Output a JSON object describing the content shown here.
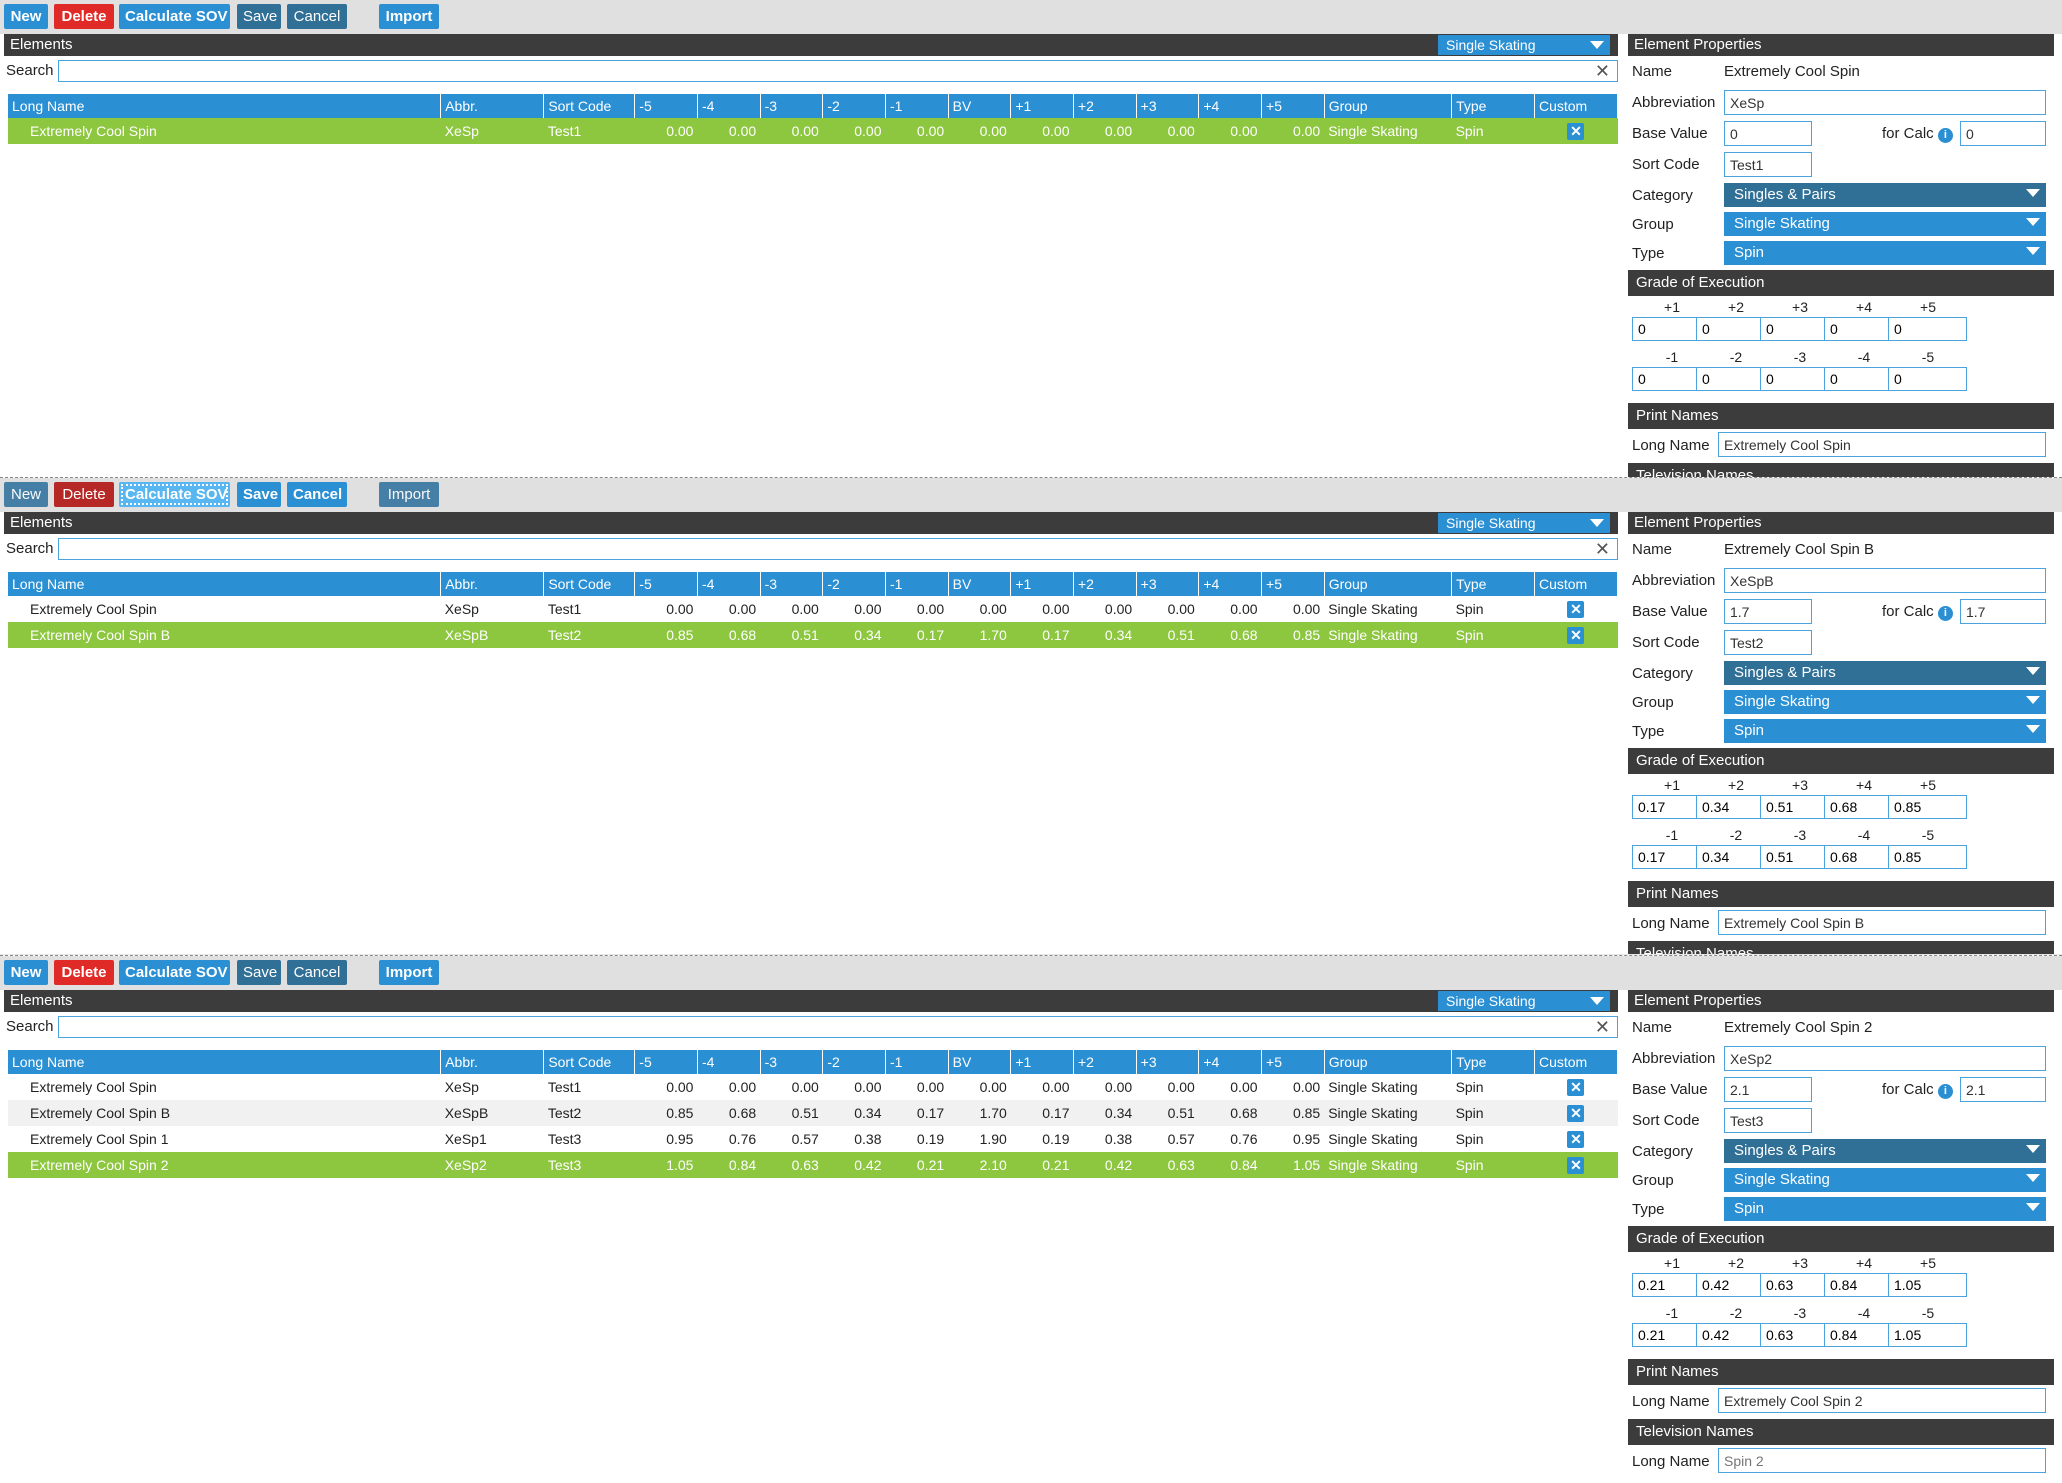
{
  "toolbar": {
    "new": "New",
    "delete": "Delete",
    "calc": "Calculate SOV",
    "save": "Save",
    "cancel": "Cancel",
    "import": "Import"
  },
  "elements_title": "Elements",
  "discipline": "Single Skating",
  "search_label": "Search",
  "columns": [
    "Long Name",
    "Abbr.",
    "Sort Code",
    "-5",
    "-4",
    "-3",
    "-2",
    "-1",
    "BV",
    "+1",
    "+2",
    "+3",
    "+4",
    "+5",
    "Group",
    "Type",
    "Custom"
  ],
  "props_labels": {
    "title": "Element Properties",
    "name": "Name",
    "abbr": "Abbreviation",
    "base": "Base Value",
    "for_calc": "for Calc",
    "sort": "Sort Code",
    "category": "Category",
    "group": "Group",
    "type": "Type",
    "goe": "Grade of Execution",
    "print": "Print Names",
    "tv": "Television Names",
    "long_name": "Long Name"
  },
  "goe_plus_labels": [
    "+1",
    "+2",
    "+3",
    "+4",
    "+5"
  ],
  "goe_minus_labels": [
    "-1",
    "-2",
    "-3",
    "-4",
    "-5"
  ],
  "panels": [
    {
      "rows": [
        [
          "Extremely Cool Spin",
          "XeSp",
          "Test1",
          "0.00",
          "0.00",
          "0.00",
          "0.00",
          "0.00",
          "0.00",
          "0.00",
          "0.00",
          "0.00",
          "0.00",
          "0.00",
          "Single Skating",
          "Spin"
        ]
      ],
      "selected": 0,
      "props": {
        "name": "Extremely Cool Spin",
        "abbr": "XeSp",
        "base": "0",
        "for_calc": "0",
        "sort": "Test1",
        "category": "Singles & Pairs",
        "group": "Single Skating",
        "type": "Spin",
        "goe_plus": [
          "0",
          "0",
          "0",
          "0",
          "0"
        ],
        "goe_minus": [
          "0",
          "0",
          "0",
          "0",
          "0"
        ],
        "print_long": "Extremely Cool Spin",
        "tv_long": ""
      }
    },
    {
      "rows": [
        [
          "Extremely Cool Spin",
          "XeSp",
          "Test1",
          "0.00",
          "0.00",
          "0.00",
          "0.00",
          "0.00",
          "0.00",
          "0.00",
          "0.00",
          "0.00",
          "0.00",
          "0.00",
          "Single Skating",
          "Spin"
        ],
        [
          "Extremely Cool Spin B",
          "XeSpB",
          "Test2",
          "0.85",
          "0.68",
          "0.51",
          "0.34",
          "0.17",
          "1.70",
          "0.17",
          "0.34",
          "0.51",
          "0.68",
          "0.85",
          "Single Skating",
          "Spin"
        ]
      ],
      "selected": 1,
      "props": {
        "name": "Extremely Cool Spin B",
        "abbr": "XeSpB",
        "base": "1.7",
        "for_calc": "1.7",
        "sort": "Test2",
        "category": "Singles & Pairs",
        "group": "Single Skating",
        "type": "Spin",
        "goe_plus": [
          "0.17",
          "0.34",
          "0.51",
          "0.68",
          "0.85"
        ],
        "goe_minus": [
          "0.17",
          "0.34",
          "0.51",
          "0.68",
          "0.85"
        ],
        "print_long": "Extremely Cool Spin B",
        "tv_long": ""
      }
    },
    {
      "rows": [
        [
          "Extremely Cool Spin",
          "XeSp",
          "Test1",
          "0.00",
          "0.00",
          "0.00",
          "0.00",
          "0.00",
          "0.00",
          "0.00",
          "0.00",
          "0.00",
          "0.00",
          "0.00",
          "Single Skating",
          "Spin"
        ],
        [
          "Extremely Cool Spin B",
          "XeSpB",
          "Test2",
          "0.85",
          "0.68",
          "0.51",
          "0.34",
          "0.17",
          "1.70",
          "0.17",
          "0.34",
          "0.51",
          "0.68",
          "0.85",
          "Single Skating",
          "Spin"
        ],
        [
          "Extremely Cool Spin 1",
          "XeSp1",
          "Test3",
          "0.95",
          "0.76",
          "0.57",
          "0.38",
          "0.19",
          "1.90",
          "0.19",
          "0.38",
          "0.57",
          "0.76",
          "0.95",
          "Single Skating",
          "Spin"
        ],
        [
          "Extremely Cool Spin 2",
          "XeSp2",
          "Test3",
          "1.05",
          "0.84",
          "0.63",
          "0.42",
          "0.21",
          "2.10",
          "0.21",
          "0.42",
          "0.63",
          "0.84",
          "1.05",
          "Single Skating",
          "Spin"
        ]
      ],
      "selected": 3,
      "props": {
        "name": "Extremely Cool Spin 2",
        "abbr": "XeSp2",
        "base": "2.1",
        "for_calc": "2.1",
        "sort": "Test3",
        "category": "Singles & Pairs",
        "group": "Single Skating",
        "type": "Spin",
        "goe_plus": [
          "0.21",
          "0.42",
          "0.63",
          "0.84",
          "1.05"
        ],
        "goe_minus": [
          "0.21",
          "0.42",
          "0.63",
          "0.84",
          "1.05"
        ],
        "print_long": "Extremely Cool Spin 2",
        "tv_long": "",
        "tv_placeholder": "Spin 2"
      }
    }
  ]
}
